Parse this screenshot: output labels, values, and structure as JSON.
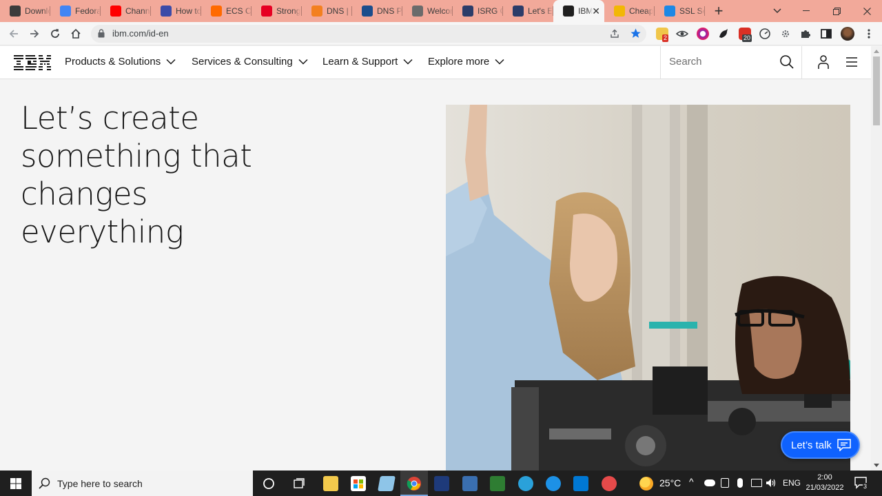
{
  "browser": {
    "tabs": [
      {
        "title": "Downlo",
        "icon": "download-icon",
        "color": "#3c3c3c"
      },
      {
        "title": "Fedora",
        "icon": "google-icon",
        "color": "#4285f4"
      },
      {
        "title": "Channe",
        "icon": "youtube-icon",
        "color": "#ff0000"
      },
      {
        "title": "How to",
        "icon": "globe-icon",
        "color": "#3b4ba8"
      },
      {
        "title": "ECS Co",
        "icon": "ecs-icon",
        "color": "#ff6a00"
      },
      {
        "title": "Strong",
        "icon": "pinterest-icon",
        "color": "#e60023"
      },
      {
        "title": "DNS | f",
        "icon": "cloudflare-icon",
        "color": "#f38020"
      },
      {
        "title": "DNS Pr",
        "icon": "dns-icon",
        "color": "#1b4d8c"
      },
      {
        "title": "Welcon",
        "icon": "globe-icon",
        "color": "#6b6b6b"
      },
      {
        "title": "ISRG C",
        "icon": "isrg-icon",
        "color": "#2c3c69"
      },
      {
        "title": "Let's E",
        "icon": "letsencrypt-icon",
        "color": "#2c3c69"
      },
      {
        "title": "IBM",
        "icon": "ibm-icon",
        "color": "#1f1f1f",
        "active": true
      },
      {
        "title": "Cheap",
        "icon": "lock-coin-icon",
        "color": "#f2b705"
      },
      {
        "title": "SSL Se",
        "icon": "ssl-icon",
        "color": "#1e88e5"
      }
    ],
    "url": "ibm.com/id-en",
    "extension_badges": {
      "red": "2",
      "gray": "20"
    }
  },
  "ibm": {
    "nav": [
      {
        "label": "Products & Solutions"
      },
      {
        "label": "Services & Consulting"
      },
      {
        "label": "Learn & Support"
      },
      {
        "label": "Explore more"
      }
    ],
    "search_placeholder": "Search",
    "hero": {
      "title_lines": [
        "Let’s create",
        "something that",
        "changes",
        "everything"
      ]
    },
    "chat_button": "Let’s talk"
  },
  "taskbar": {
    "search_placeholder": "Type here to search",
    "weather": "25°C",
    "lang": "ENG",
    "time": "2:00",
    "date": "21/03/2022",
    "notifications": "3"
  }
}
